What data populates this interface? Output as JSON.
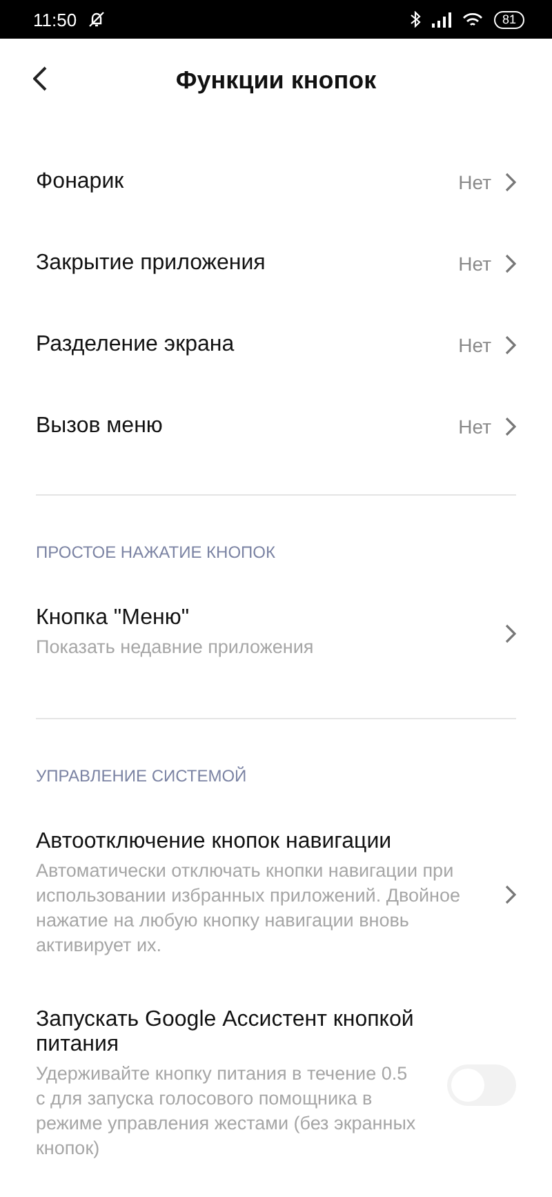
{
  "status_bar": {
    "time": "11:50",
    "battery": "81"
  },
  "header": {
    "title": "Функции кнопок"
  },
  "shortcuts": [
    {
      "label": "Фонарик",
      "value": "Нет"
    },
    {
      "label": "Закрытие приложения",
      "value": "Нет"
    },
    {
      "label": "Разделение экрана",
      "value": "Нет"
    },
    {
      "label": "Вызов меню",
      "value": "Нет"
    }
  ],
  "sections": [
    {
      "title": "ПРОСТОЕ НАЖАТИЕ КНОПОК",
      "items": [
        {
          "kind": "link",
          "label": "Кнопка \"Меню\"",
          "description": "Показать недавние приложения"
        }
      ]
    },
    {
      "title": "УПРАВЛЕНИЕ СИСТЕМОЙ",
      "items": [
        {
          "kind": "link",
          "label": "Автоотключение кнопок навигации",
          "description": "Автоматически отключать кнопки навигации при использовании избранных приложений. Двойное нажатие на любую кнопку навигации вновь активирует их."
        },
        {
          "kind": "toggle",
          "label": "Запускать Google Ассистент кнопкой питания",
          "description": "Удерживайте кнопку питания в течение 0.5 с для запуска голосового помощника в режиме управления жестами (без экранных кнопок)",
          "on": false
        }
      ]
    }
  ]
}
